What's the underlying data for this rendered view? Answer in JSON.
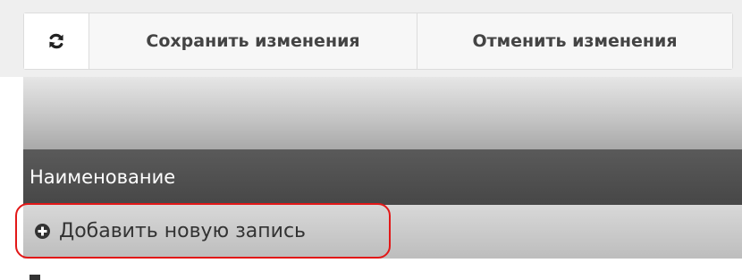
{
  "toolbar": {
    "refresh_icon": "refresh-icon",
    "save_label": "Сохранить изменения",
    "cancel_label": "Отменить изменения"
  },
  "grid": {
    "column_header": "Наименование",
    "add_record_icon": "plus-circle-icon",
    "add_record_label": "Добавить новую запись"
  },
  "colors": {
    "highlight_border": "#e21818",
    "header_dark": "#4b4b4b",
    "toolbar_bg": "#efefef"
  }
}
